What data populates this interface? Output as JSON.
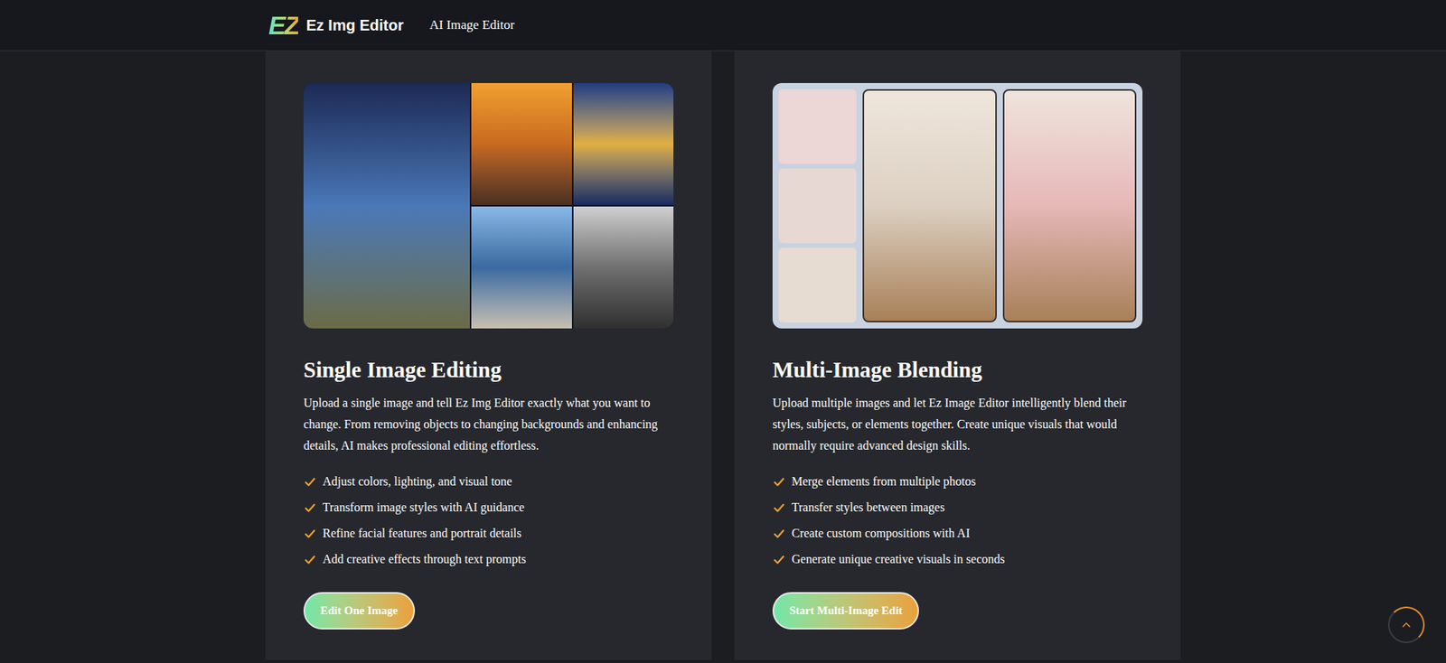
{
  "header": {
    "logo_mark": "EZ",
    "brand": "Ez Img Editor",
    "nav": [
      "AI Image Editor"
    ]
  },
  "cards": [
    {
      "title": "Single Image Editing",
      "description": "Upload a single image and tell Ez Img Editor exactly what you want to change. From removing objects to changing backgrounds and enhancing details, AI makes professional editing effortless.",
      "features": [
        "Adjust colors, lighting, and visual tone",
        "Transform image styles with AI guidance",
        "Refine facial features and portrait details",
        "Add creative effects through text prompts"
      ],
      "button": "Edit One Image",
      "kind": "single"
    },
    {
      "title": "Multi-Image Blending",
      "description": "Upload multiple images and let Ez Image Editor intelligently blend their styles, subjects, or elements together. Create unique visuals that would normally require advanced design skills.",
      "features": [
        "Merge elements from multiple photos",
        "Transfer styles between images",
        "Create custom compositions with AI",
        "Generate unique creative visuals in seconds"
      ],
      "button": "Start Multi-Image Edit",
      "kind": "multi"
    }
  ]
}
